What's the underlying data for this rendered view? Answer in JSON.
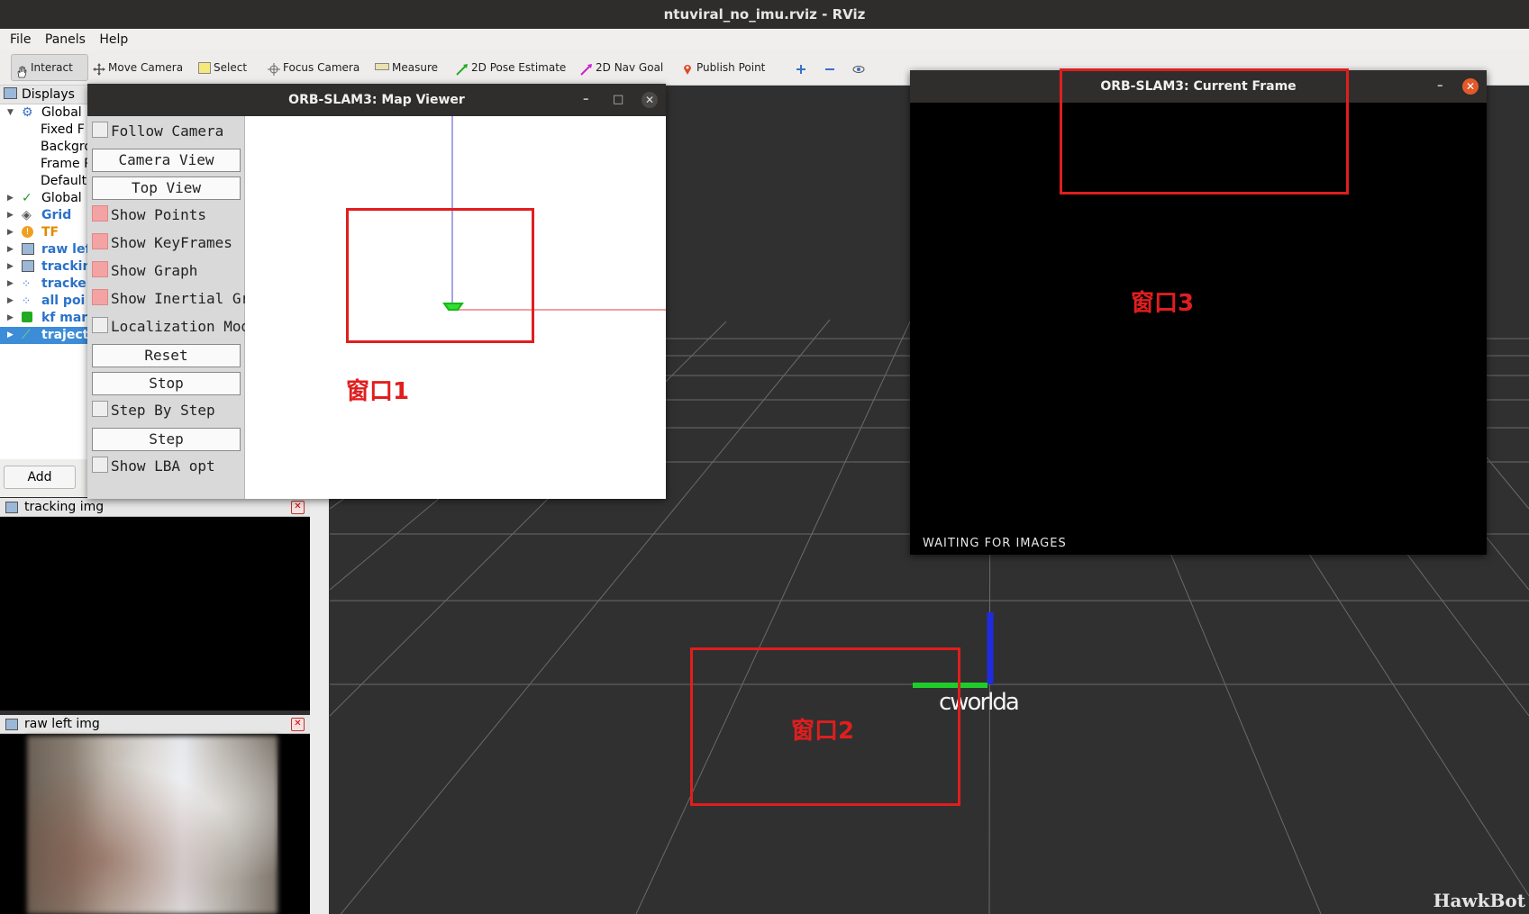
{
  "window": {
    "title": "ntuviral_no_imu.rviz - RViz"
  },
  "menu": {
    "file": "File",
    "panels": "Panels",
    "help": "Help"
  },
  "toolbar": {
    "interact": "Interact",
    "move_camera": "Move Camera",
    "select": "Select",
    "focus_camera": "Focus Camera",
    "measure": "Measure",
    "pose_estimate": "2D Pose Estimate",
    "nav_goal": "2D Nav Goal",
    "publish_point": "Publish Point"
  },
  "displays": {
    "title": "Displays",
    "items": [
      {
        "label": "Global",
        "child": false
      },
      {
        "label": "Fixed F",
        "child": true
      },
      {
        "label": "Backgro",
        "child": true
      },
      {
        "label": "Frame R",
        "child": true
      },
      {
        "label": "Default",
        "child": true
      },
      {
        "label": "Global !",
        "child": false
      },
      {
        "label": "Grid",
        "child": false
      },
      {
        "label": "TF",
        "child": false
      },
      {
        "label": "raw lef",
        "child": false
      },
      {
        "label": "trackin",
        "child": false
      },
      {
        "label": "tracke",
        "child": false
      },
      {
        "label": "all poi",
        "child": false
      },
      {
        "label": "kf mar",
        "child": false
      },
      {
        "label": "traject",
        "child": false
      }
    ],
    "add_label": "Add"
  },
  "panels": {
    "tracking": {
      "title": "tracking img"
    },
    "raw": {
      "title": "raw left img"
    }
  },
  "map_viewer": {
    "title": "ORB-SLAM3: Map Viewer",
    "follow_camera": "Follow Camera",
    "camera_view": "Camera View",
    "top_view": "Top View",
    "show_points": "Show Points",
    "show_keyframes": "Show KeyFrames",
    "show_graph": "Show Graph",
    "show_inertial_graph": "Show Inertial Graph",
    "localization_mode": "Localization Mode",
    "reset": "Reset",
    "stop": "Stop",
    "step_by_step": "Step By Step",
    "step": "Step",
    "show_lba_opt": "Show LBA opt"
  },
  "current_frame": {
    "title": "ORB-SLAM3: Current Frame",
    "status": "WAITING FOR IMAGES"
  },
  "annotations": {
    "window1": "窗口1",
    "window2": "窗口2",
    "window3": "窗口3"
  },
  "scene": {
    "axis_label": "cworlda"
  },
  "watermark": "HawkBot",
  "colors": {
    "annotation_red": "#e01e1e",
    "selection_blue": "#3c8cd8",
    "checkbox_on": "#f3a3a3"
  }
}
